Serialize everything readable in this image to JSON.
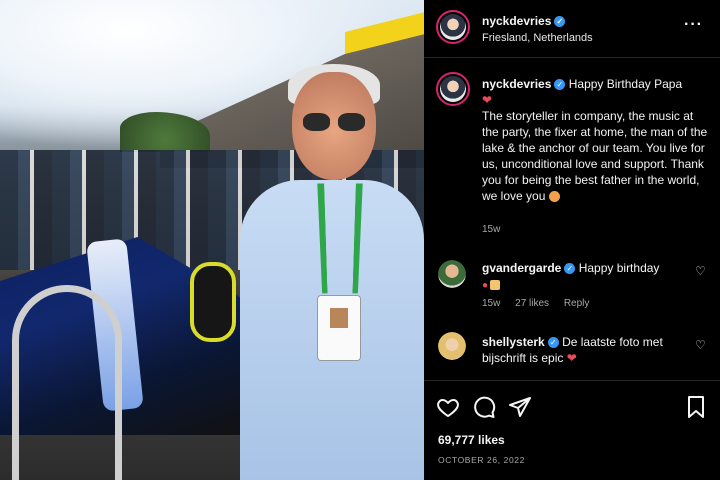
{
  "post": {
    "author": {
      "handle": "nyckdevries",
      "location": "Friesland, Netherlands",
      "verified": true
    },
    "more_icon": "more-horizontal-icon",
    "caption": {
      "handle": "nyckdevries",
      "headline": "Happy Birthday Papa",
      "text": "The storyteller in company, the music at the party, the fixer at home, the man of the lake & the anchor of our team. You live for us, unconditional love and support. Thank you for being the best father in the world, we love you",
      "time": "15w"
    },
    "comments": [
      {
        "handle": "gvandergarde",
        "text": "Happy birthday",
        "time": "15w",
        "likes": "27 likes",
        "reply": "Reply"
      },
      {
        "handle": "shellysterk",
        "text": "De laatste foto met bijschrift is epic"
      }
    ],
    "likes": "69,777 likes",
    "date": "OCTOBER 26, 2022"
  },
  "colors": {
    "accent_verified": "#3897f0",
    "heart": "#ed4956",
    "background": "#000000",
    "muted": "#a8a8a8"
  },
  "icons": [
    "heart-icon",
    "comment-icon",
    "share-icon",
    "bookmark-icon",
    "verified-icon"
  ]
}
